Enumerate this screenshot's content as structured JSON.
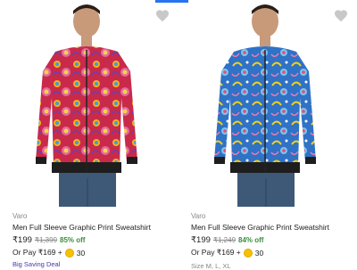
{
  "products": [
    {
      "brand": "Varo",
      "title": "Men Full Sleeve Graphic Print Sweatshirt",
      "price": "₹199",
      "mrp": "₹1,399",
      "discount": "85% off",
      "pay_prefix": "Or Pay ₹169 +",
      "coins": "30",
      "deal": "Big Saving Deal",
      "image_icon": "red-printed-sweatshirt-photo"
    },
    {
      "brand": "Varo",
      "title": "Men Full Sleeve Graphic Print Sweatshirt",
      "price": "₹199",
      "mrp": "₹1,249",
      "discount": "84% off",
      "pay_prefix": "Or Pay ₹169 +",
      "coins": "30",
      "size_label": "Size M, L, XL",
      "image_icon": "blue-printed-sweatshirt-photo"
    }
  ],
  "colors": {
    "accent": "#2874f0",
    "discount": "#388e3c",
    "deal": "#4a35a8"
  }
}
